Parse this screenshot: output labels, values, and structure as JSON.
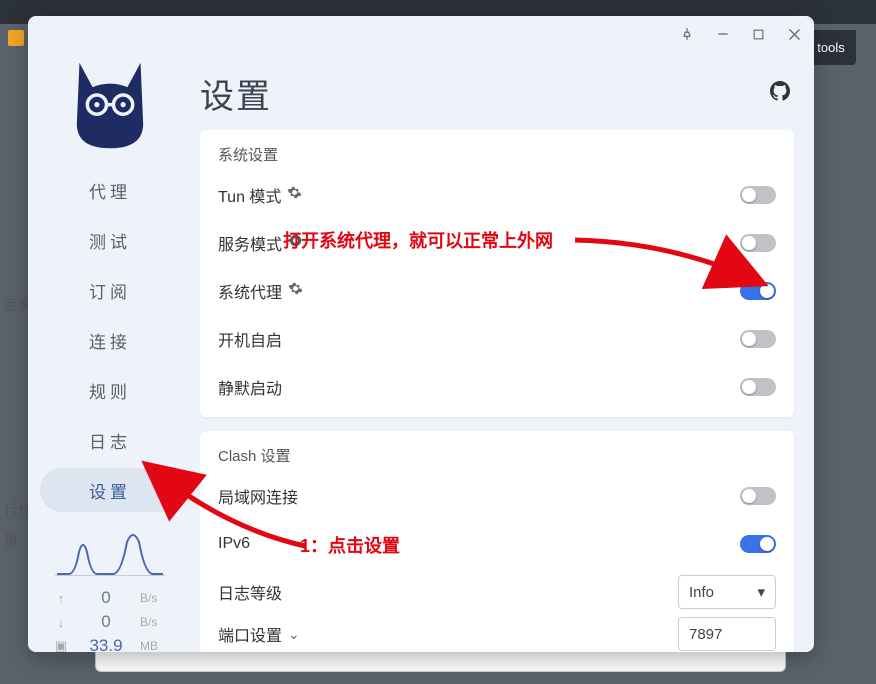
{
  "bg": {
    "tools_label": "tools",
    "left_text_1": "距离",
    "left_text_2": "行作",
    "left_text_3": "重"
  },
  "titlebar": {
    "pin": "pin-icon",
    "minimize": "minimize-icon",
    "maximize": "maximize-icon",
    "close": "close-icon"
  },
  "sidebar": {
    "items": [
      {
        "label": "代理"
      },
      {
        "label": "测试"
      },
      {
        "label": "订阅"
      },
      {
        "label": "连接"
      },
      {
        "label": "规则"
      },
      {
        "label": "日志"
      },
      {
        "label": "设置"
      }
    ],
    "active_index": 6,
    "stats": {
      "up_value": "0",
      "up_unit": "B/s",
      "down_value": "0",
      "down_unit": "B/s",
      "mem_value": "33.9",
      "mem_unit": "MB"
    }
  },
  "main": {
    "title": "设置",
    "github": "github-icon",
    "card1": {
      "title": "系统设置",
      "rows": [
        {
          "label": "Tun 模式",
          "gear": true,
          "toggle": false
        },
        {
          "label": "服务模式",
          "gear": true,
          "toggle": false
        },
        {
          "label": "系统代理",
          "gear": true,
          "toggle": true
        },
        {
          "label": "开机自启",
          "gear": false,
          "toggle": false
        },
        {
          "label": "静默启动",
          "gear": false,
          "toggle": false
        }
      ]
    },
    "card2": {
      "title": "Clash 设置",
      "rows": [
        {
          "label": "局域网连接",
          "toggle": false
        },
        {
          "label": "IPv6",
          "toggle": true
        }
      ],
      "log_row_label": "日志等级",
      "log_value": "Info",
      "port_row_label": "端口设置",
      "port_value": "7897"
    }
  },
  "annotations": {
    "top_text": "打开系统代理，就可以正常上外网",
    "bottom_text": "1：点击设置"
  }
}
